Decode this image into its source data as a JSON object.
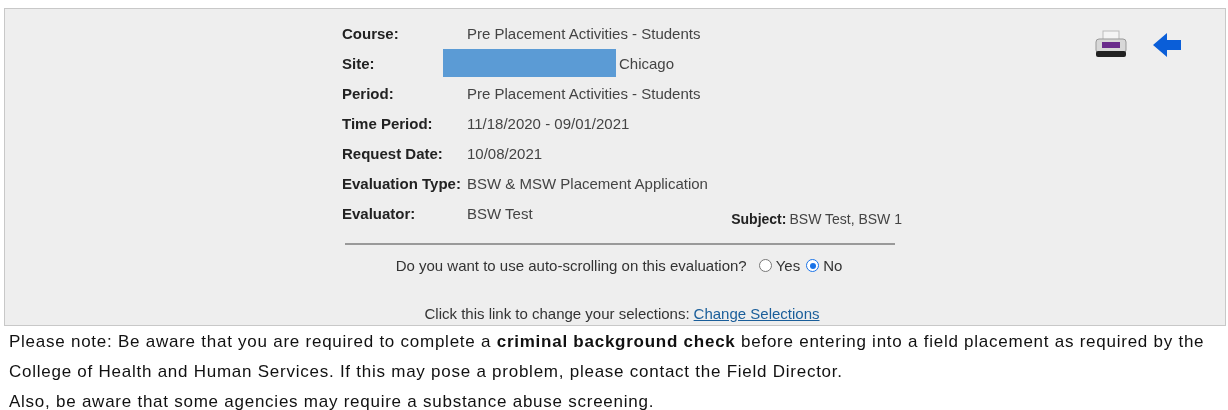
{
  "details": [
    {
      "label": "Course:",
      "value": "Pre Placement Activities - Students"
    },
    {
      "label": "Site:",
      "value": "Chicago",
      "redacted": true
    },
    {
      "label": "Period:",
      "value": "Pre Placement Activities - Students"
    },
    {
      "label": "Time Period:",
      "value": "11/18/2020 - 09/01/2021"
    },
    {
      "label": "Request Date:",
      "value": "10/08/2021"
    },
    {
      "label": "Evaluation Type:",
      "value": "BSW & MSW Placement Application"
    },
    {
      "label": "Evaluator:",
      "value": "BSW Test"
    }
  ],
  "subject": {
    "label": "Subject:",
    "value": "BSW Test, BSW 1"
  },
  "auto_scroll": {
    "question": "Do you want to use auto-scrolling on this evaluation?",
    "options": [
      {
        "label": "Yes",
        "selected": false
      },
      {
        "label": "No",
        "selected": true
      }
    ]
  },
  "change": {
    "text": "Click this link to change your selections:",
    "link": "Change Selections"
  },
  "notes": [
    "Please note: Be aware that you are required to complete a **criminal background check** before entering into a field placement as required by the College of Health and Human Services. If this may pose a problem, please contact the Field Director.",
    "Also, be aware that some agencies may require a substance abuse screening."
  ]
}
